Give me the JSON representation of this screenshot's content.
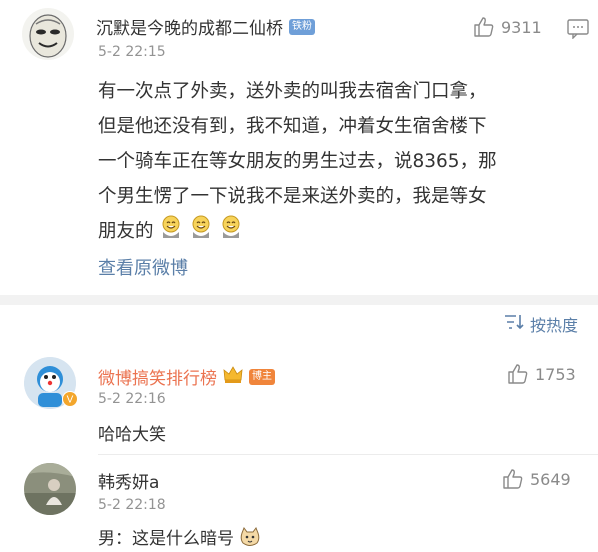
{
  "post": {
    "username": "沉默是今晚的成都二仙桥",
    "fan_badge": "铁粉",
    "time": "5-2 22:15",
    "likes": "9311",
    "body_lines": [
      "有一次点了外卖，送外卖的叫我去宿舍门口拿，",
      "但是他还没有到，我不知道，冲着女生宿舍楼下",
      "一个骑车正在等女朋友的男生过去，说8365，那",
      "个男生愣了一下说我不是来送外卖的，我是等女",
      "朋友的"
    ],
    "view_original": "查看原微博"
  },
  "sort_label": "按热度",
  "comments": [
    {
      "username": "微博搞笑排行榜",
      "badge": "博主",
      "time": "5-2 22:16",
      "likes": "1753",
      "text": "哈哈大笑"
    },
    {
      "username": "韩秀妍a",
      "time": "5-2 22:18",
      "likes": "5649",
      "text": "男：这是什么暗号"
    }
  ],
  "colors": {
    "link": "#5b7fa8",
    "orange_name": "#eb7350",
    "meta": "#939393"
  }
}
